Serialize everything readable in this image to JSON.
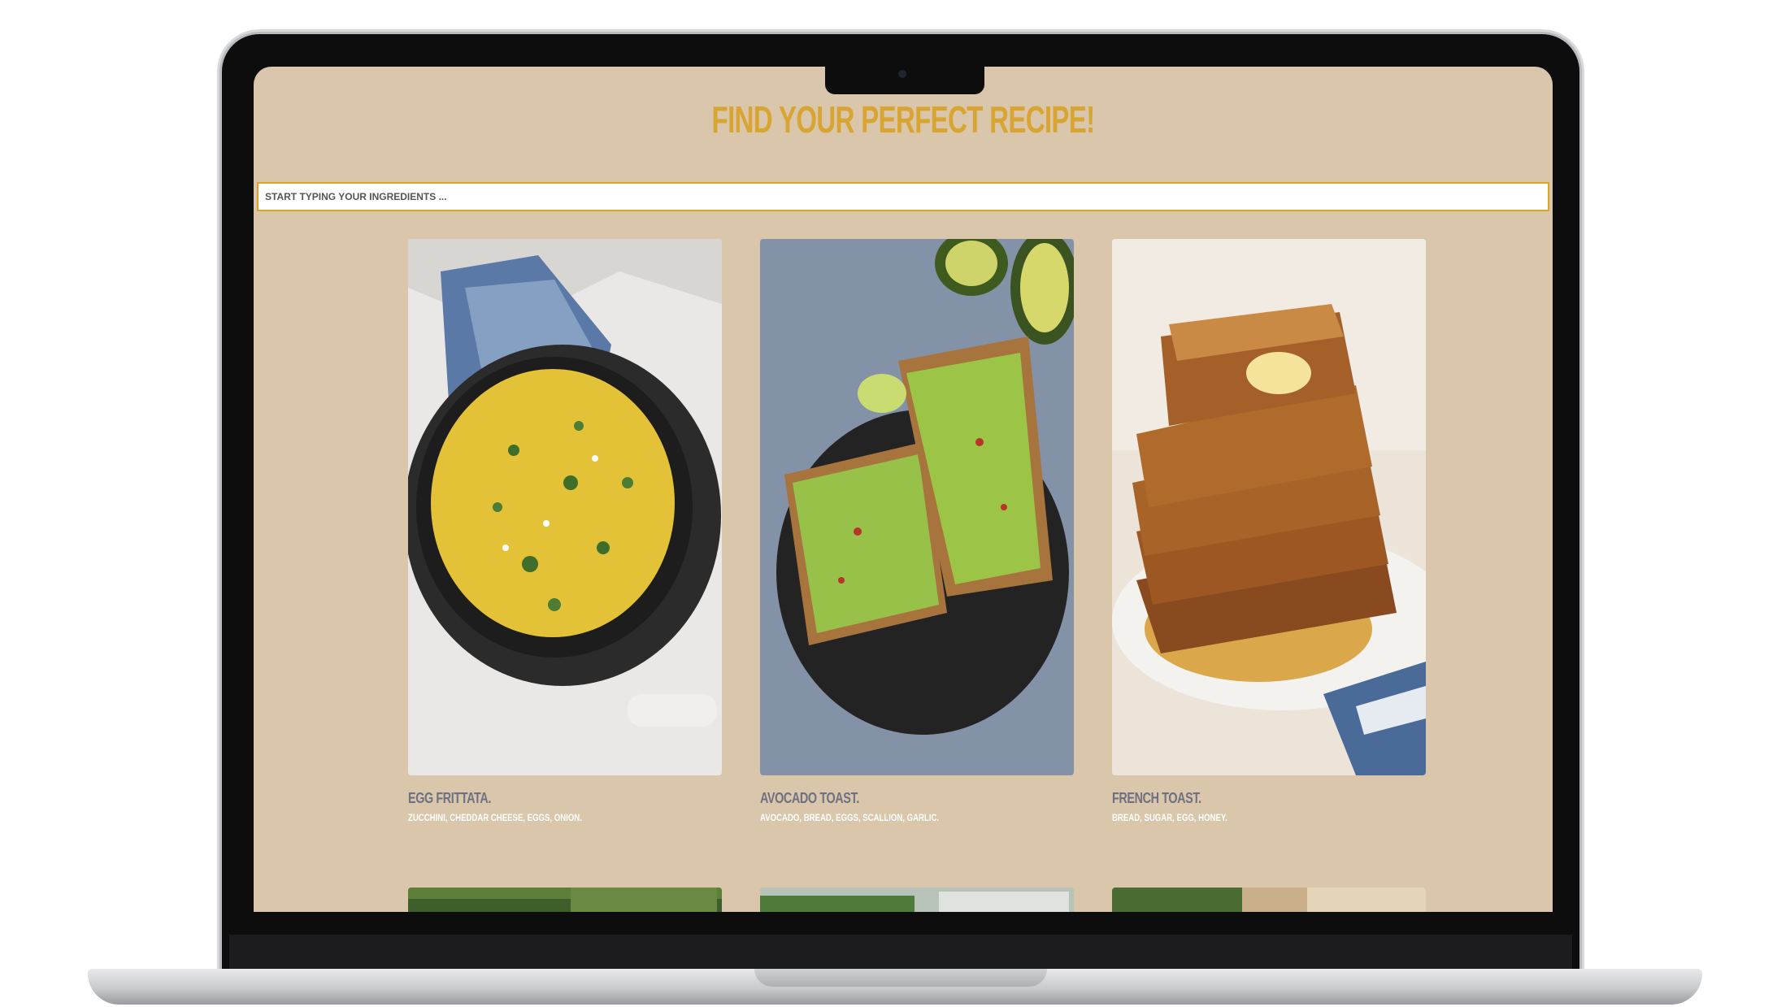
{
  "page": {
    "title": "FIND YOUR PERFECT RECIPE!",
    "search_placeholder": "START TYPING YOUR INGREDIENTS ..."
  },
  "colors": {
    "background": "#dac6aa",
    "accent": "#d9a532",
    "card_title": "#6f7180",
    "ingredients": "#ffffff"
  },
  "recipes": [
    {
      "title": "EGG FRITTATA.",
      "ingredients": "ZUCCHINI, CHEDDAR CHEESE, EGGS, ONION.",
      "image": "egg-frittata-photo"
    },
    {
      "title": "AVOCADO TOAST.",
      "ingredients": "AVOCADO, BREAD, EGGS, SCALLION, GARLIC.",
      "image": "avocado-toast-photo"
    },
    {
      "title": "FRENCH TOAST.",
      "ingredients": "BREAD, SUGAR, EGG, HONEY.",
      "image": "french-toast-photo"
    }
  ]
}
